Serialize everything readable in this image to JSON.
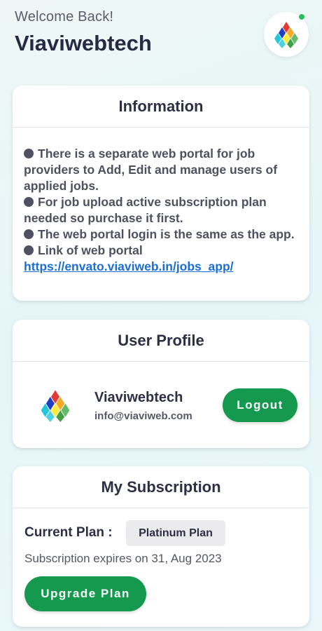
{
  "header": {
    "welcome": "Welcome Back!",
    "title": "Viaviwebtech",
    "online_color": "#21c45a"
  },
  "information": {
    "title": "Information",
    "lines": [
      "There is a separate web portal for job providers to Add, Edit and manage users of applied jobs.",
      "For job upload active subscription plan needed so purchase it first.",
      "The web portal login is the same as the app.",
      "Link of web portal "
    ],
    "link_text": "https://envato.viaviweb.in/jobs_app/"
  },
  "profile": {
    "title": "User Profile",
    "name": "Viaviwebtech",
    "email": "info@viaviweb.com",
    "logout_label": "Logout",
    "logo_icon": "viaviweb-logo-icon"
  },
  "subscription": {
    "title": "My Subscription",
    "current_plan_label": "Current Plan :",
    "plan_name": "Platinum Plan",
    "expiry_text": "Subscription expires on 31, Aug 2023",
    "upgrade_label": "Upgrade Plan"
  },
  "colors": {
    "accent_green": "#14994e",
    "link_blue": "#1a6ed8"
  }
}
